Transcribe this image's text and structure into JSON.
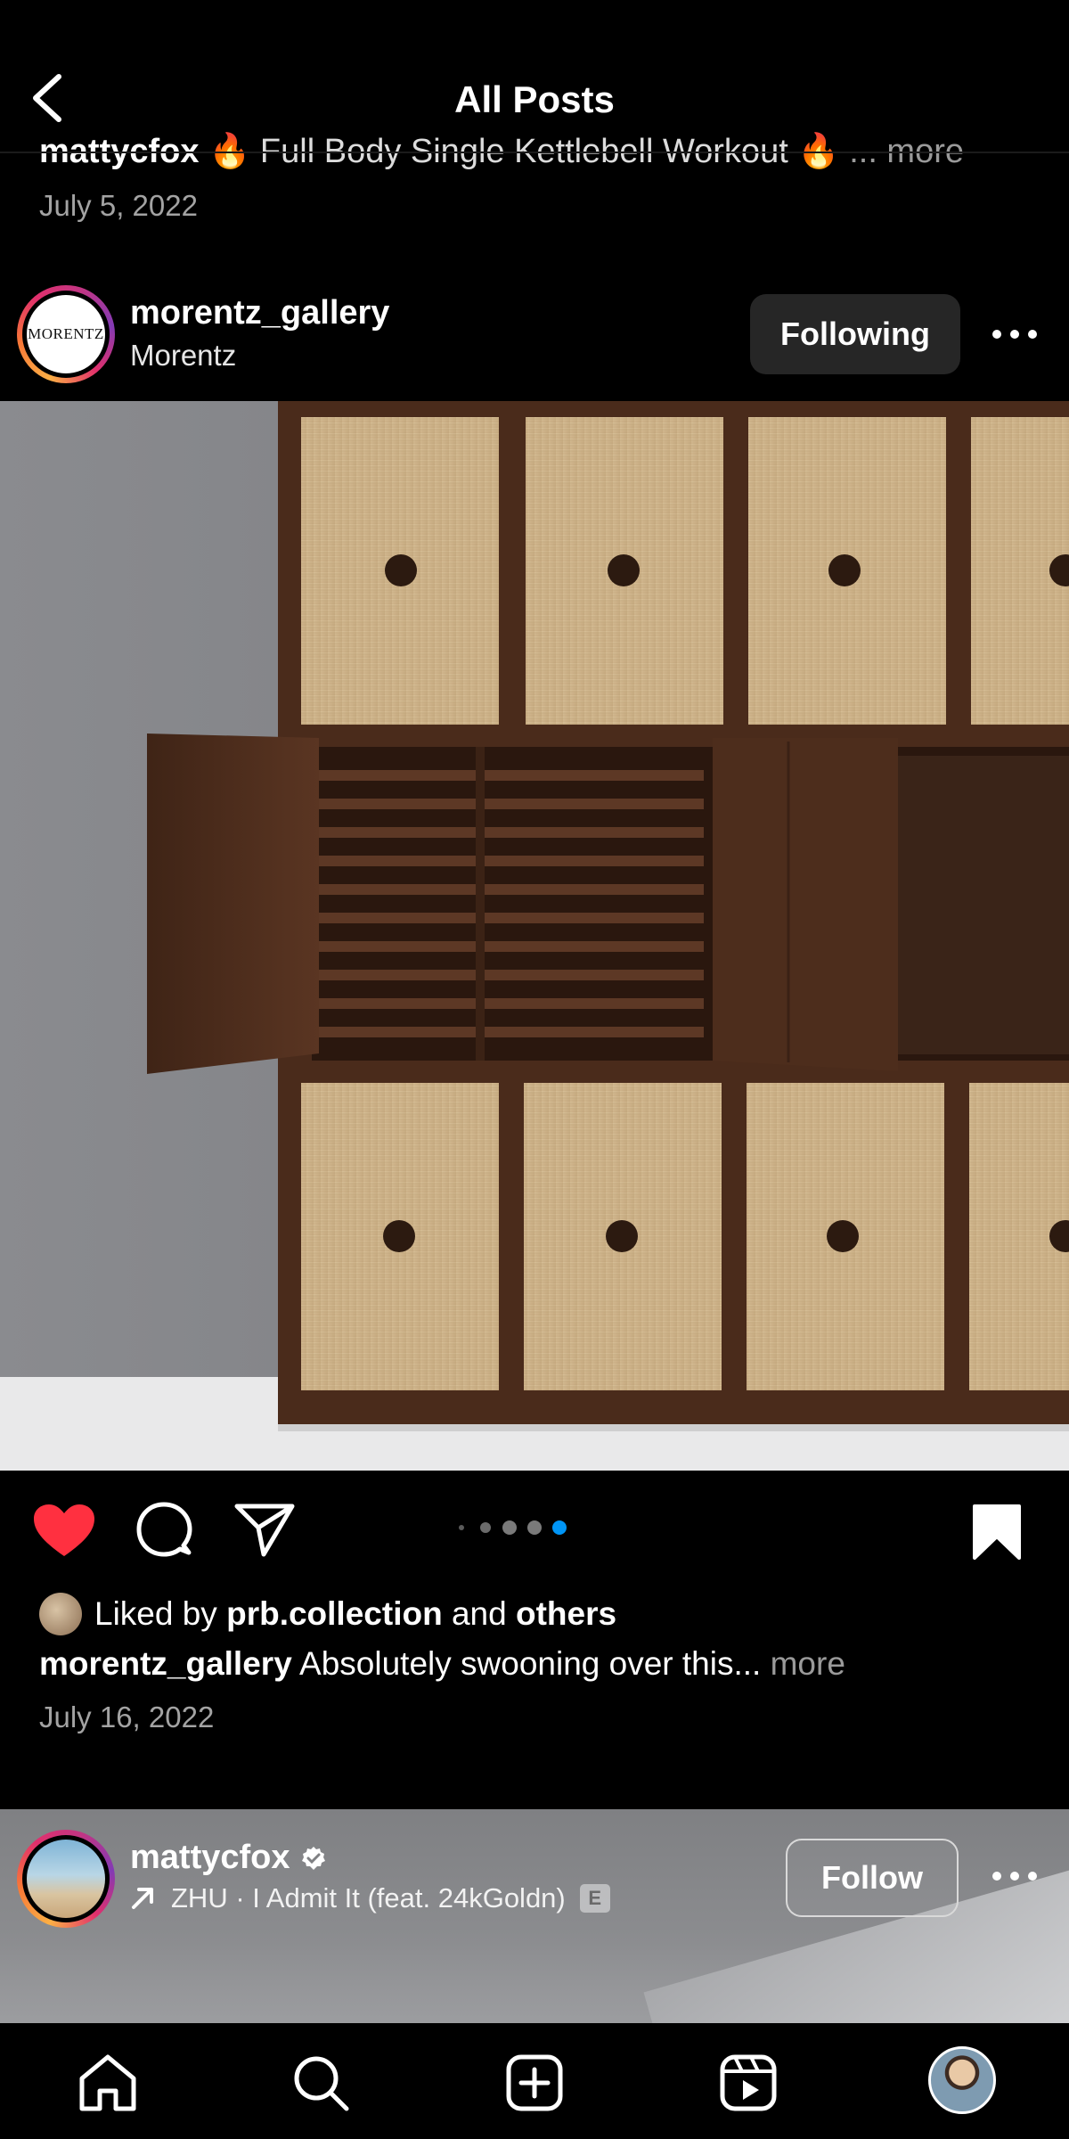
{
  "header": {
    "title": "All Posts"
  },
  "previous_post": {
    "caption_user": "mattycfox",
    "caption_text": "🔥 Full Body Single Kettlebell Workout 🔥",
    "caption_more": "... more",
    "date": "July 5, 2022"
  },
  "post": {
    "avatar_text": "MORENTZ",
    "username": "morentz_gallery",
    "subtitle": "Morentz",
    "follow_state": "Following",
    "carousel": {
      "count": 4,
      "active_index": 3
    },
    "liked": true,
    "saved": true,
    "likes": {
      "prefix": "Liked by",
      "user": "prb.collection",
      "conj": "and",
      "others": "others"
    },
    "caption": {
      "user": "morentz_gallery",
      "text": "Absolutely swooning over this...",
      "more": "more"
    },
    "date": "July 16, 2022"
  },
  "next_post": {
    "username": "mattycfox",
    "verified": true,
    "music": "ZHU · I Admit It (feat. 24kGoldn)",
    "explicit": "E",
    "follow_label": "Follow"
  },
  "nav": [
    "home-icon",
    "search-icon",
    "create-icon",
    "reels-icon",
    "profile-avatar"
  ],
  "colors": {
    "like": "#ff3040",
    "carousel_active": "#0095f6",
    "following_bg": "#262626"
  }
}
